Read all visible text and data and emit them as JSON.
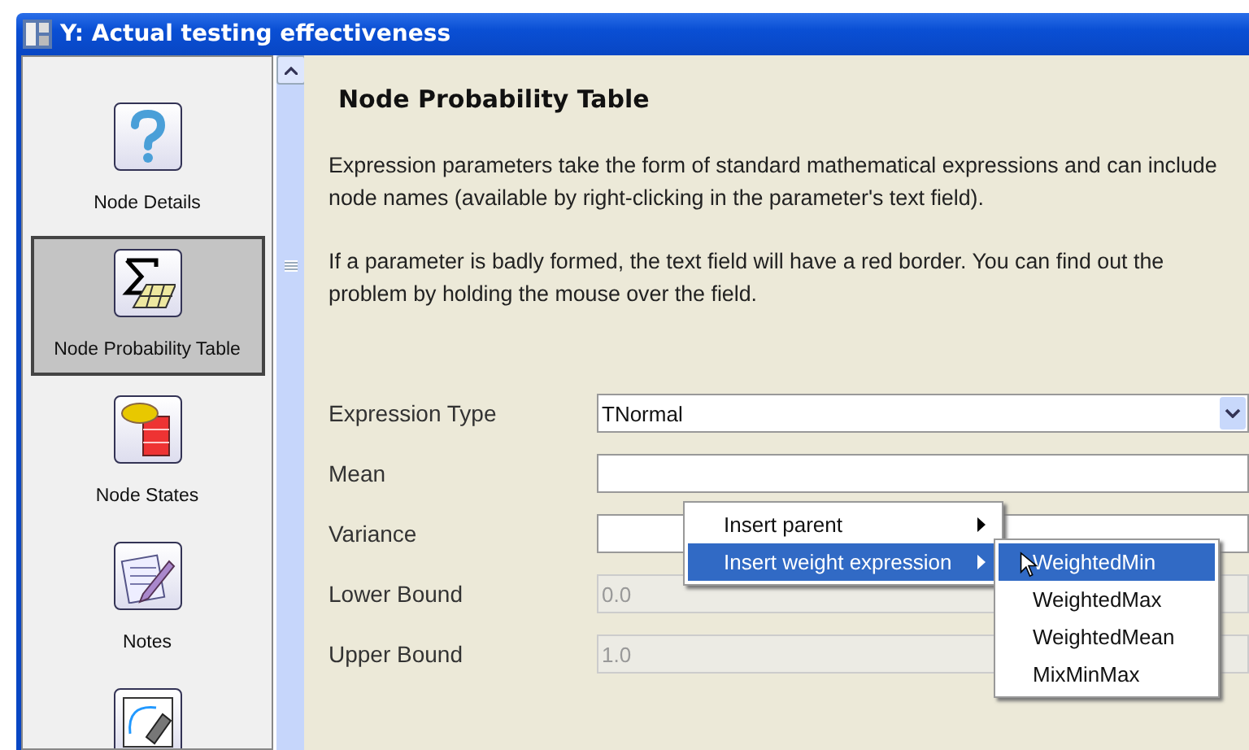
{
  "window": {
    "title": "Y: Actual testing effectiveness"
  },
  "sidebar": {
    "items": [
      {
        "kind": "help",
        "label": "Node Details",
        "selected": false
      },
      {
        "kind": "table",
        "label": "Node Probability Table",
        "selected": true
      },
      {
        "kind": "states",
        "label": "Node States",
        "selected": false
      },
      {
        "kind": "notes",
        "label": "Notes",
        "selected": false
      },
      {
        "kind": "design",
        "selected": false
      }
    ]
  },
  "content": {
    "heading": "Node Probability Table",
    "paragraphs": [
      "Expression parameters take the form of standard mathematical expressions and can include node names (available by right-clicking in the parameter's text field).",
      "If a parameter is badly formed, the text field will have a red border. You can find out the problem by holding the mouse over the field."
    ],
    "fields": [
      {
        "kind": "dropdown",
        "label": "Expression Type",
        "value": "TNormal",
        "disabled": false
      },
      {
        "kind": "text",
        "label": "Mean",
        "disabled": false
      },
      {
        "kind": "text",
        "label": "Variance",
        "disabled": false
      },
      {
        "kind": "text",
        "label": "Lower Bound",
        "value": "0.0",
        "disabled": true
      },
      {
        "kind": "text",
        "label": "Upper Bound",
        "value": "1.0",
        "disabled": true
      }
    ]
  },
  "context_menu": {
    "items": [
      {
        "label": "Insert parent",
        "selected": false,
        "submenu": true
      },
      {
        "label": "Insert weight expression",
        "selected": true,
        "submenu": true
      }
    ]
  },
  "submenu": {
    "items": [
      {
        "label": "WeightedMin",
        "selected": true
      },
      {
        "label": "WeightedMax",
        "selected": false
      },
      {
        "label": "WeightedMean",
        "selected": false
      },
      {
        "label": "MixMinMax",
        "selected": false
      }
    ]
  }
}
